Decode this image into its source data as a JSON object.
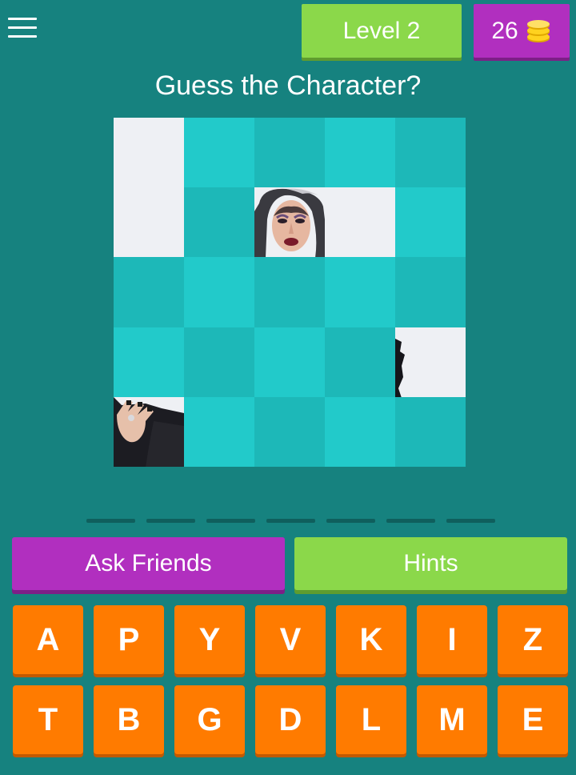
{
  "header": {
    "level_label": "Level 2",
    "coins": "26",
    "coin_icon": "coin-stack-icon",
    "menu_icon": "hamburger-menu-icon"
  },
  "question": "Guess the Character?",
  "puzzle": {
    "rows": 5,
    "cols": 5,
    "revealed_tiles": [
      "row1-col1",
      "row2-col1",
      "row2-col3",
      "row2-col4",
      "row4-col5",
      "row5-col1"
    ]
  },
  "answer": {
    "letter_count": 7
  },
  "actions": {
    "ask_friends": "Ask Friends",
    "hints": "Hints"
  },
  "keyboard": {
    "row1": [
      "A",
      "P",
      "Y",
      "V",
      "K",
      "I",
      "Z"
    ],
    "row2": [
      "T",
      "B",
      "G",
      "D",
      "L",
      "M",
      "E"
    ]
  },
  "colors": {
    "background": "#16827f",
    "tile_teal_dark": "#1db8b8",
    "tile_teal_light": "#22caca",
    "purple": "#b12fbf",
    "green": "#8bd84a",
    "orange": "#ff7b00"
  }
}
